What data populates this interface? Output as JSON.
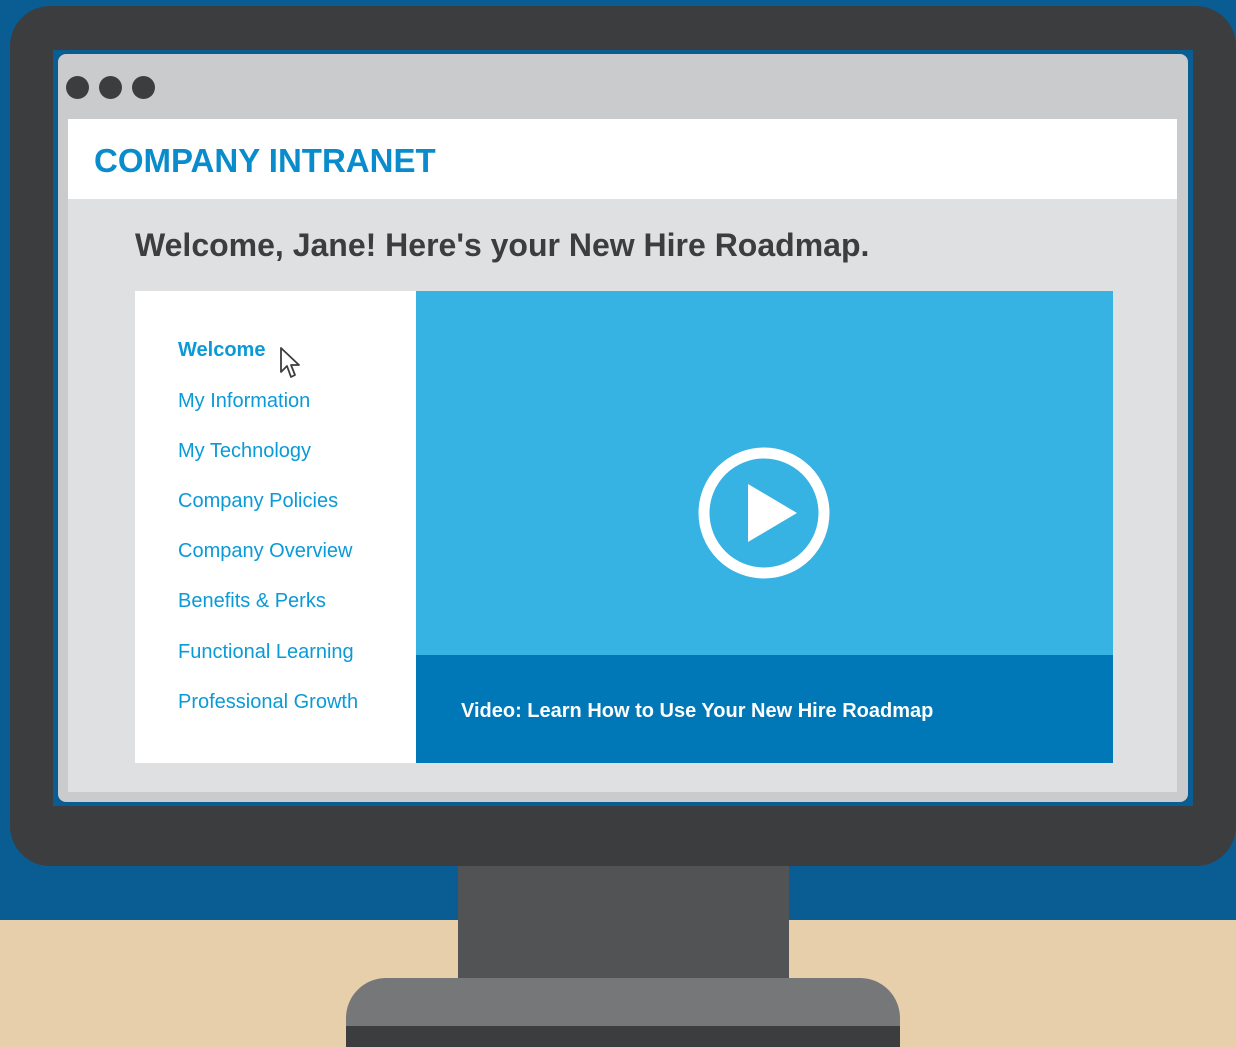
{
  "colors": {
    "wall": "#0a5d93",
    "desk": "#e8cfab",
    "monitor_frame": "#3c3d3f",
    "brand_blue": "#0a8ccc",
    "video_bg": "#36b2e3",
    "caption_bg": "#0077b6"
  },
  "intranet": {
    "title": "COMPANY INTRANET",
    "welcome_heading": "Welcome, Jane! Here's your New Hire Roadmap."
  },
  "nav": {
    "items": [
      {
        "label": "Welcome",
        "active": true
      },
      {
        "label": "My Information"
      },
      {
        "label": "My Technology"
      },
      {
        "label": "Company Policies"
      },
      {
        "label": "Company Overview"
      },
      {
        "label": "Benefits & Perks"
      },
      {
        "label": "Functional Learning"
      },
      {
        "label": "Professional Growth"
      }
    ]
  },
  "video": {
    "icon": "play-icon",
    "caption": "Video: Learn How to Use Your New Hire Roadmap"
  },
  "icons": {
    "cursor": "mouse-pointer-icon",
    "window_controls": "window-dot-icon"
  }
}
